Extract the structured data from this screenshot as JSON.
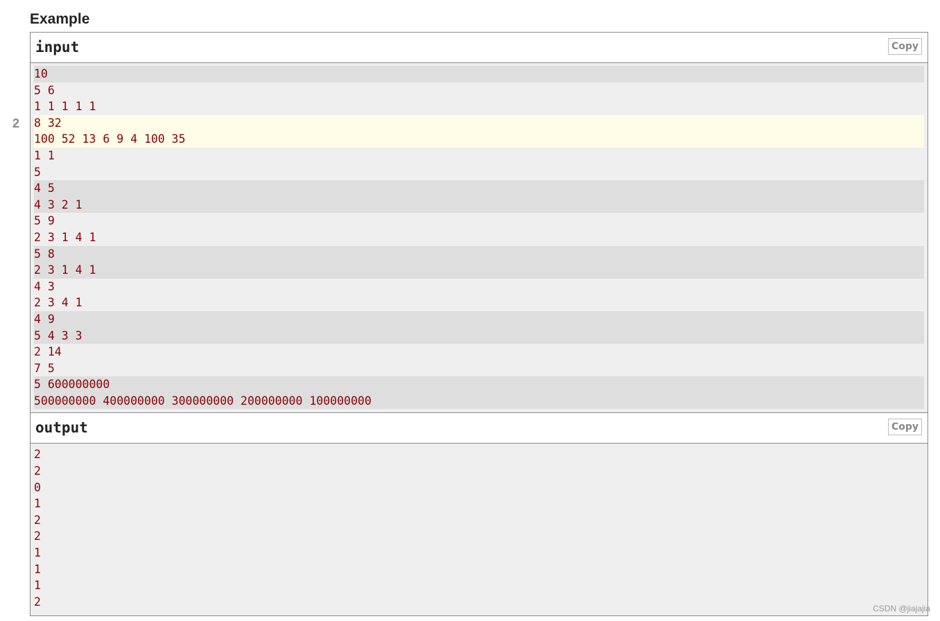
{
  "section_title": "Example",
  "copy_label": "Copy",
  "highlighted_test_marker": "2",
  "input": {
    "label": "input",
    "test_count": "10",
    "tests": [
      [
        "5 6",
        "1 1 1 1 1"
      ],
      [
        "8 32",
        "100 52 13 6 9 4 100 35"
      ],
      [
        "1 1",
        "5"
      ],
      [
        "4 5",
        "4 3 2 1"
      ],
      [
        "5 9",
        "2 3 1 4 1"
      ],
      [
        "5 8",
        "2 3 1 4 1"
      ],
      [
        "4 3",
        "2 3 4 1"
      ],
      [
        "4 9",
        "5 4 3 3"
      ],
      [
        "2 14",
        "7 5"
      ],
      [
        "5 600000000",
        "500000000 400000000 300000000 200000000 100000000"
      ]
    ],
    "highlighted_test": 2
  },
  "output": {
    "label": "output",
    "lines": [
      "2",
      "2",
      "0",
      "1",
      "2",
      "2",
      "1",
      "1",
      "1",
      "2"
    ]
  },
  "watermark": "CSDN @jiajajia",
  "colors": {
    "text": "#8b0000",
    "highlight": "#fffde8",
    "stripe": "#dedede",
    "background": "#efefef"
  }
}
